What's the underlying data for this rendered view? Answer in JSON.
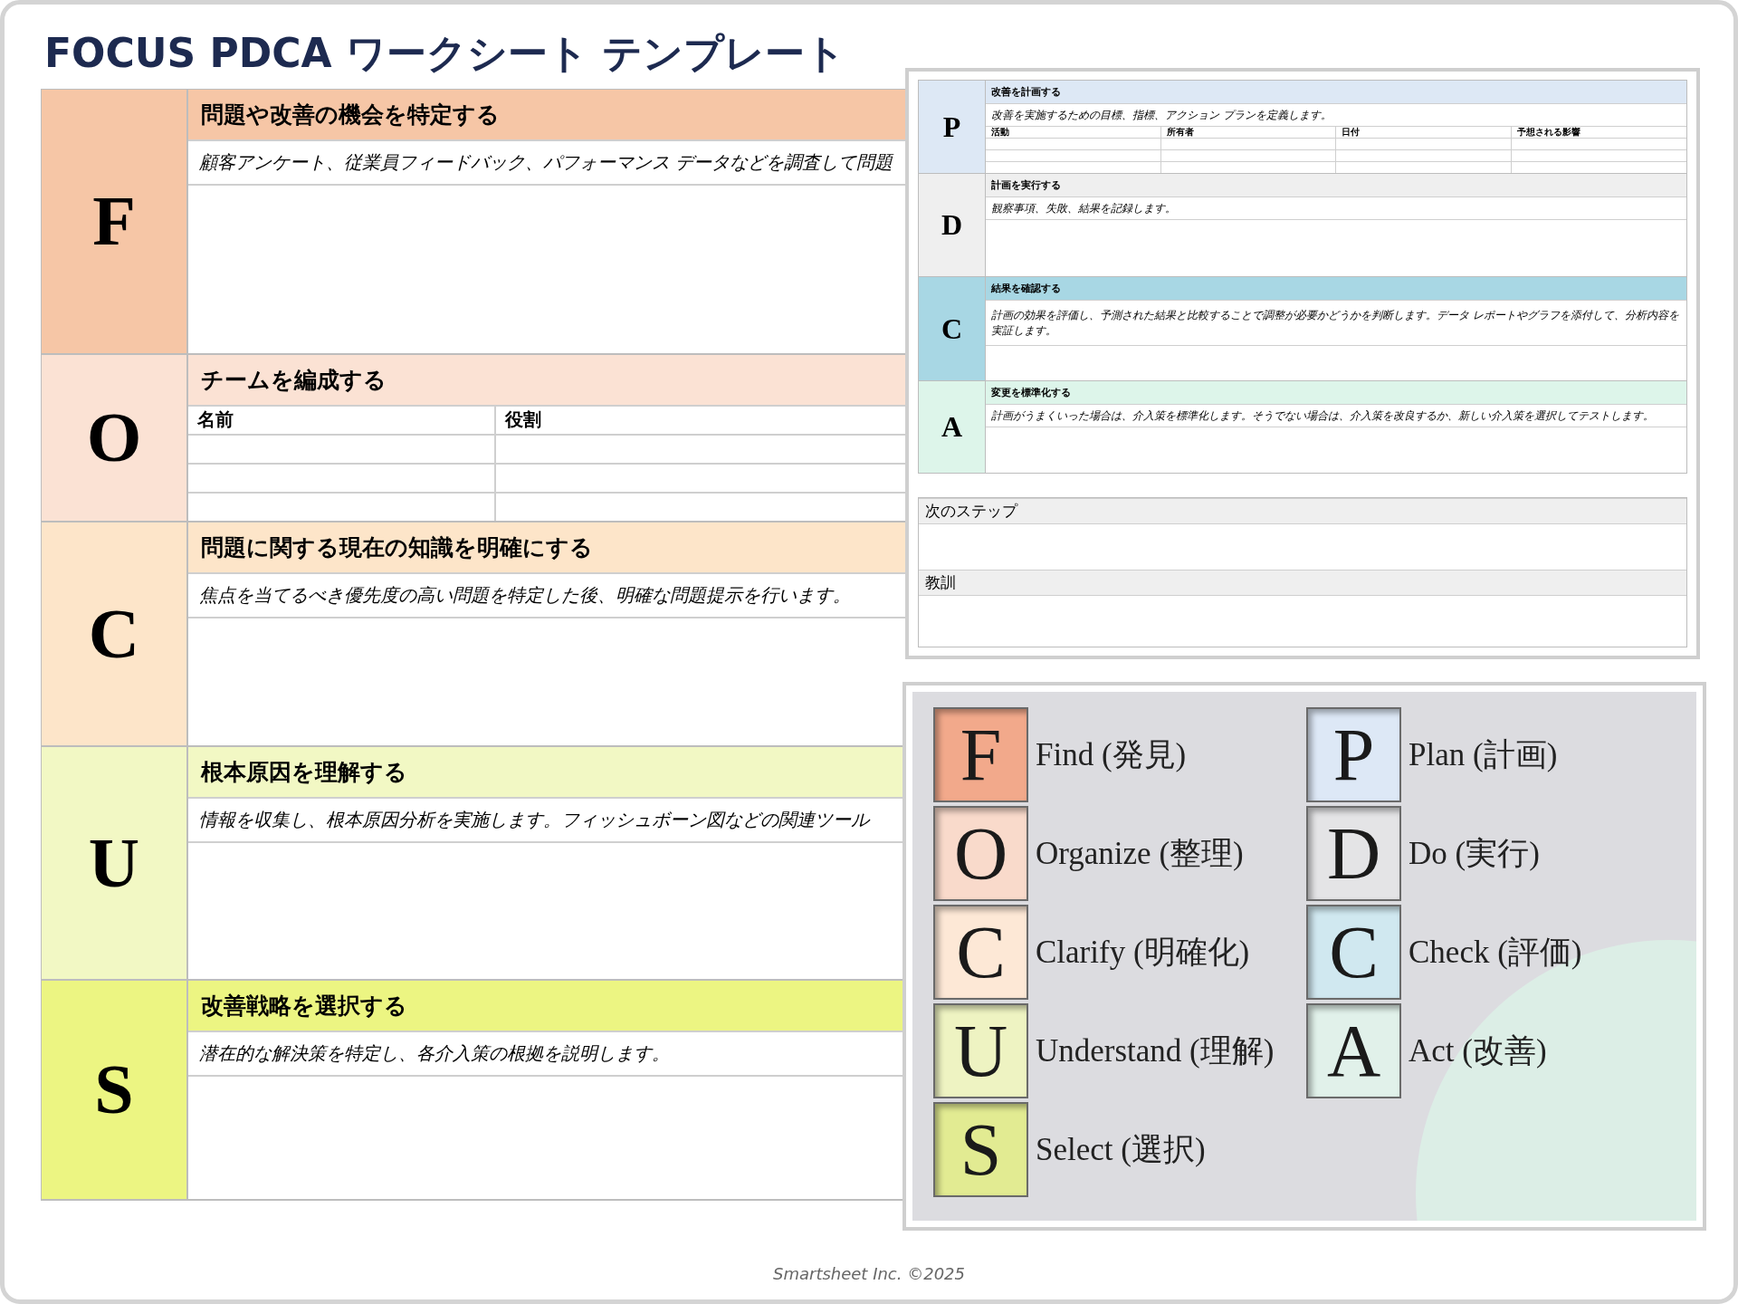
{
  "title": "FOCUS PDCA ワークシート テンプレート",
  "focus_sheet": {
    "sections": [
      {
        "letter": "F",
        "color": "#f6c6a6",
        "heading": "問題や改善の機会を特定する",
        "kind": "description",
        "description": "顧客アンケート、従業員フィードバック、パフォーマンス データなどを調査して問題"
      },
      {
        "letter": "O",
        "color": "#fbe2d4",
        "heading": "チームを編成する",
        "kind": "table",
        "columns": [
          "名前",
          "役割"
        ]
      },
      {
        "letter": "C",
        "color": "#fde5c9",
        "heading": "問題に関する現在の知識を明確にする",
        "kind": "description",
        "description": "焦点を当てるべき優先度の高い問題を特定した後、明確な問題提示を行います。"
      },
      {
        "letter": "U",
        "color": "#f2f8c4",
        "heading": "根本原因を理解する",
        "kind": "description",
        "description": "情報を収集し、根本原因分析を実施します。フィッシュボーン図などの関連ツール"
      },
      {
        "letter": "S",
        "color": "#ecf582",
        "heading": "改善戦略を選択する",
        "kind": "description",
        "description": "潜在的な解決策を特定し、各介入策の根拠を説明します。"
      }
    ]
  },
  "pdca_sheet": {
    "sections": [
      {
        "letter": "P",
        "color": "#dde8f5",
        "heading": "改善を計画する",
        "kind": "table",
        "description": "改善を実施するための目標、指標、アクション プランを定義します。",
        "columns": [
          "活動",
          "所有者",
          "日付",
          "予想される影響"
        ]
      },
      {
        "letter": "D",
        "color": "#efefef",
        "heading": "計画を実行する",
        "kind": "description",
        "description": "観察事項、失敗、結果を記録します。"
      },
      {
        "letter": "C",
        "color": "#a8d7e4",
        "heading": "結果を確認する",
        "kind": "description",
        "description": "計画の効果を評価し、予測された結果と比較することで調整が必要かどうかを判断します。データ レポートやグラフを添付して、分析内容を実証します。"
      },
      {
        "letter": "A",
        "color": "#ddf5ea",
        "heading": "変更を標準化する",
        "kind": "description",
        "description": "計画がうまくいった場合は、介入策を標準化します。そうでない場合は、介入策を改良するか、新しい介入策を選択してテストします。"
      }
    ],
    "notes": [
      {
        "heading": "次のステップ"
      },
      {
        "heading": "教訓"
      }
    ]
  },
  "legend": {
    "focus": [
      {
        "letter": "F",
        "label": "Find (発見)",
        "color": "#f2a98b"
      },
      {
        "letter": "O",
        "label": "Organize (整理)",
        "color": "#f9dacb"
      },
      {
        "letter": "C",
        "label": "Clarify (明確化)",
        "color": "#fde8d6"
      },
      {
        "letter": "U",
        "label": "Understand (理解)",
        "color": "#eef3c2"
      },
      {
        "letter": "S",
        "label": "Select (選択)",
        "color": "#e2eb92"
      }
    ],
    "pdca": [
      {
        "letter": "P",
        "label": "Plan (計画)",
        "color": "#dde8f6"
      },
      {
        "letter": "D",
        "label": "Do (実行)",
        "color": "#e4e4e6"
      },
      {
        "letter": "C",
        "label": "Check (評価)",
        "color": "#d0e8f0"
      },
      {
        "letter": "A",
        "label": "Act (改善)",
        "color": "#e1f1ea"
      }
    ]
  },
  "footer": "Smartsheet Inc. ©2025"
}
